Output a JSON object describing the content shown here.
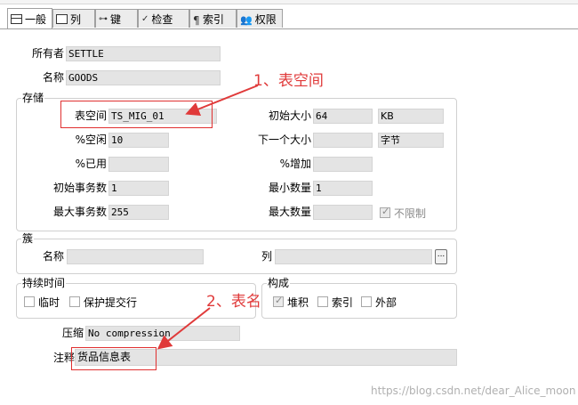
{
  "tabs": [
    {
      "label": "一般",
      "icon": "general-icon",
      "active": true
    },
    {
      "label": "列",
      "icon": "columns-icon",
      "active": false
    },
    {
      "label": "键",
      "icon": "key-icon",
      "active": false
    },
    {
      "label": "检查",
      "icon": "check-icon",
      "active": false
    },
    {
      "label": "索引",
      "icon": "index-icon",
      "active": false
    },
    {
      "label": "权限",
      "icon": "permissions-icon",
      "active": false
    }
  ],
  "owner": {
    "label": "所有者",
    "value": "SETTLE"
  },
  "name": {
    "label": "名称",
    "value": "GOODS"
  },
  "storage": {
    "title": "存储",
    "tablespace": {
      "label": "表空间",
      "value": "TS_MIG_01"
    },
    "pct_free": {
      "label": "%空闲",
      "value": "10"
    },
    "pct_used": {
      "label": "%已用",
      "value": ""
    },
    "initial_trans": {
      "label": "初始事务数",
      "value": "1"
    },
    "max_trans": {
      "label": "最大事务数",
      "value": "255"
    },
    "initial_size": {
      "label": "初始大小",
      "value": "64",
      "unit": "KB"
    },
    "next_size": {
      "label": "下一个大小",
      "value": "",
      "unit": "字节"
    },
    "pct_increase": {
      "label": "%增加",
      "value": ""
    },
    "min_extents": {
      "label": "最小数量",
      "value": "1"
    },
    "max_extents": {
      "label": "最大数量",
      "value": "",
      "unlimited_label": "不限制",
      "unlimited_checked": true
    }
  },
  "cluster": {
    "title": "簇",
    "name_label": "名称",
    "name_value": "",
    "columns_label": "列",
    "columns_value": "",
    "more_button": "..."
  },
  "duration": {
    "title": "持续时间",
    "temporary": {
      "label": "临时",
      "checked": false
    },
    "preserve_rows": {
      "label": "保护提交行",
      "checked": false
    }
  },
  "organization": {
    "title": "构成",
    "heap": {
      "label": "堆积",
      "checked": true
    },
    "index": {
      "label": "索引",
      "checked": false
    },
    "external": {
      "label": "外部",
      "checked": false
    }
  },
  "compression": {
    "label": "压缩",
    "value": "No compression"
  },
  "comment": {
    "label": "注释",
    "value": "货品信息表"
  },
  "annotations": {
    "tablespace": "1、表空间",
    "tablename": "2、表名"
  },
  "watermark": "https://blog.csdn.net/dear_Alice_moon",
  "colors": {
    "annotation": "#e03a3a",
    "field_bg": "#e4e4e4"
  }
}
